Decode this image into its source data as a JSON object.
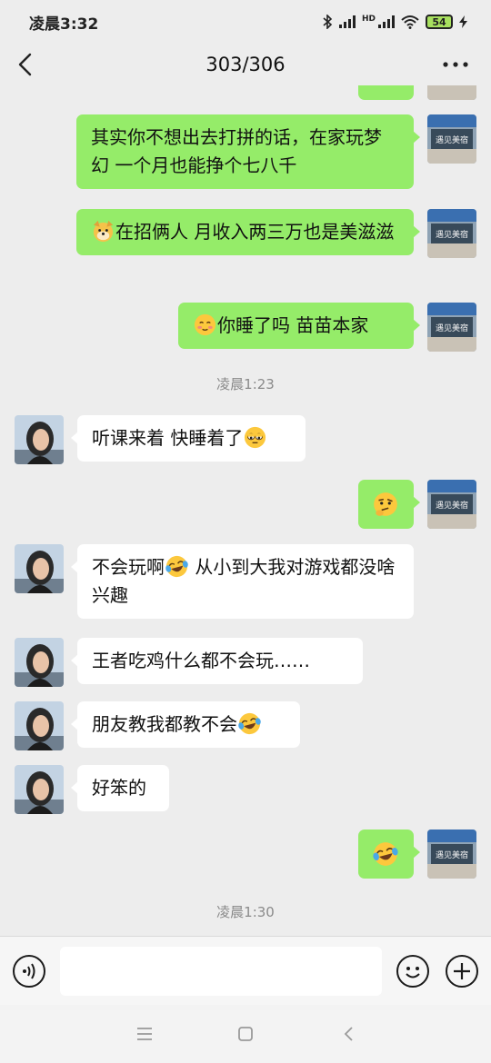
{
  "status_bar": {
    "time": "凌晨3:32",
    "network_label": "HD",
    "battery": "54"
  },
  "header": {
    "title": "303/306"
  },
  "messages": {
    "m1": {
      "text": "其实你不想出去打拼的话，在家玩梦幻 一个月也能挣个七八千"
    },
    "m2": {
      "text": "在招俩人  月收入两三万也是美滋滋",
      "emoji": "dog-face-emoji"
    },
    "m3": {
      "text": "你睡了吗  苗苗本家",
      "emoji": "blushing-face-emoji"
    },
    "time1": "凌晨1:23",
    "m4": {
      "text": "听课来着 快睡着了",
      "emoji": "sleepy-eyes-emoji"
    },
    "m5": {
      "emoji": "thinking-face-emoji"
    },
    "m6": {
      "text_a": "不会玩啊",
      "text_b": " 从小到大我对游戏都没啥兴趣",
      "emoji": "crying-laughing-emoji"
    },
    "m7": {
      "text": "王者吃鸡什么都不会玩……"
    },
    "m8": {
      "text": "朋友教我都教不会",
      "emoji": "crying-laughing-emoji"
    },
    "m9": {
      "text": "好笨的"
    },
    "m10": {
      "emoji": "crying-laughing-emoji"
    },
    "time2": "凌晨1:30"
  },
  "avatar_self": {
    "sign_text": "遇见美宿",
    "icon": "storefront-avatar"
  },
  "avatar_other": {
    "icon": "person-avatar"
  },
  "input_bar": {
    "value": "",
    "voice_icon": "voice-icon",
    "emoji_icon": "smiley-icon",
    "more_icon": "plus-icon"
  },
  "system_nav": {
    "menu_icon": "menu-icon",
    "home_icon": "home-icon",
    "back_icon": "back-triangle-icon"
  },
  "colors": {
    "outgoing_bubble": "#95ec69",
    "incoming_bubble": "#ffffff",
    "background": "#ededed"
  }
}
